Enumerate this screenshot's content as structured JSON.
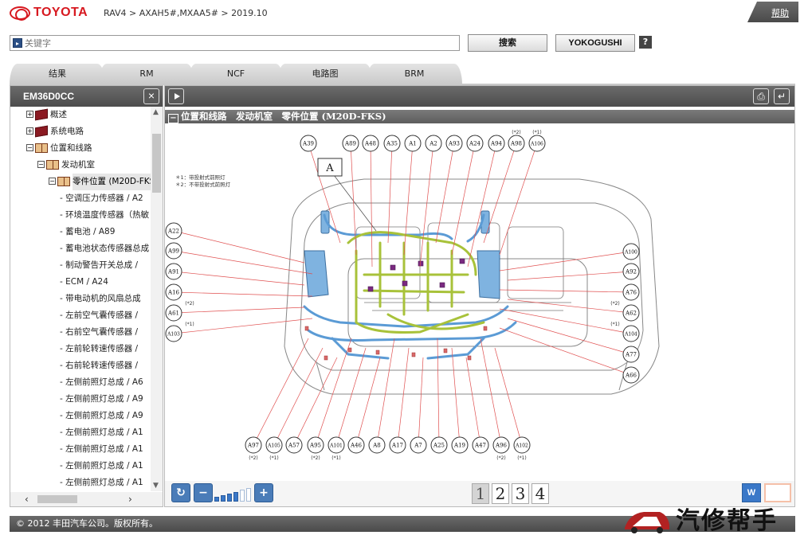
{
  "header": {
    "logo_text": "TOYOTA",
    "breadcrumb": "RAV4 > AXAH5#,MXAA5# > 2019.10",
    "help_label": "帮助"
  },
  "search": {
    "placeholder": "关键字",
    "search_label": "搜索",
    "yoko_label": "YOKOGUSHI",
    "help_icon_label": "?"
  },
  "tabs": [
    "结果",
    "RM",
    "NCF",
    "电路图",
    "BRM"
  ],
  "left_panel": {
    "title": "EM36D0CC",
    "tree": [
      {
        "label": "概述",
        "level": 1,
        "expander": "+",
        "icon": "closed-book-icon"
      },
      {
        "label": "系统电路",
        "level": 1,
        "expander": "+",
        "icon": "closed-book-icon"
      },
      {
        "label": "位置和线路",
        "level": 1,
        "expander": "−",
        "icon": "open-book-icon"
      },
      {
        "label": "发动机室",
        "level": 2,
        "expander": "−",
        "icon": "open-book-icon"
      },
      {
        "label": "零件位置 (M20D-FKS",
        "level": 3,
        "expander": "−",
        "icon": "open-book-icon",
        "selected": true
      },
      {
        "label": "空调压力传感器 / A2",
        "level": 4
      },
      {
        "label": "环境温度传感器（热敏",
        "level": 4
      },
      {
        "label": "蓄电池 / A89",
        "level": 4
      },
      {
        "label": "蓄电池状态传感器总成",
        "level": 4
      },
      {
        "label": "制动警告开关总成 /",
        "level": 4
      },
      {
        "label": "ECM / A24",
        "level": 4
      },
      {
        "label": "带电动机的风扇总成",
        "level": 4
      },
      {
        "label": "左前空气囊传感器 /",
        "level": 4
      },
      {
        "label": "右前空气囊传感器 /",
        "level": 4
      },
      {
        "label": "左前轮转速传感器 /",
        "level": 4
      },
      {
        "label": "右前轮转速传感器 /",
        "level": 4
      },
      {
        "label": "左侧前照灯总成 / A6",
        "level": 4
      },
      {
        "label": "左侧前照灯总成 / A9",
        "level": 4
      },
      {
        "label": "左侧前照灯总成 / A9",
        "level": 4
      },
      {
        "label": "左侧前照灯总成 / A1",
        "level": 4
      },
      {
        "label": "左侧前照灯总成 / A1",
        "level": 4
      },
      {
        "label": "左侧前照灯总成 / A1",
        "level": 4
      },
      {
        "label": "左侧前照灯总成 / A1",
        "level": 4
      }
    ]
  },
  "main": {
    "title_minus": "−",
    "title": "位置和线路　发动机室　零件位置 (M20D-FKS)",
    "legend": [
      "＊1：带投射式前照灯",
      "＊2：不带投射式前照灯"
    ],
    "view_label": "A",
    "top_connectors": [
      {
        "id": "A39",
        "note": ""
      },
      {
        "id": "A89",
        "note": ""
      },
      {
        "id": "A48",
        "note": ""
      },
      {
        "id": "A35",
        "note": ""
      },
      {
        "id": "A1",
        "note": ""
      },
      {
        "id": "A2",
        "note": ""
      },
      {
        "id": "A93",
        "note": ""
      },
      {
        "id": "A24",
        "note": ""
      },
      {
        "id": "A94",
        "note": ""
      },
      {
        "id": "A98",
        "note": "(*2)"
      },
      {
        "id": "A106",
        "note": "(*1)"
      }
    ],
    "left_connectors": [
      {
        "id": "A22",
        "note": ""
      },
      {
        "id": "A99",
        "note": ""
      },
      {
        "id": "A91",
        "note": ""
      },
      {
        "id": "A16",
        "note": ""
      },
      {
        "id": "A61",
        "note": "(*2)"
      },
      {
        "id": "A103",
        "note": "(*1)"
      }
    ],
    "right_connectors": [
      {
        "id": "A100",
        "note": ""
      },
      {
        "id": "A92",
        "note": ""
      },
      {
        "id": "A76",
        "note": ""
      },
      {
        "id": "A62",
        "note": "(*2)"
      },
      {
        "id": "A104",
        "note": "(*1)"
      },
      {
        "id": "A77",
        "note": ""
      },
      {
        "id": "A66",
        "note": ""
      }
    ],
    "bottom_connectors": [
      {
        "id": "A97",
        "note": "(*2)"
      },
      {
        "id": "A105",
        "note": "(*1)"
      },
      {
        "id": "A57",
        "note": ""
      },
      {
        "id": "A95",
        "note": "(*2)"
      },
      {
        "id": "A101",
        "note": "(*1)"
      },
      {
        "id": "A46",
        "note": ""
      },
      {
        "id": "A8",
        "note": ""
      },
      {
        "id": "A17",
        "note": ""
      },
      {
        "id": "A7",
        "note": ""
      },
      {
        "id": "A25",
        "note": ""
      },
      {
        "id": "A19",
        "note": ""
      },
      {
        "id": "A47",
        "note": ""
      },
      {
        "id": "A96",
        "note": "(*2)"
      },
      {
        "id": "A102",
        "note": "(*1)"
      }
    ],
    "pages": [
      "1",
      "2",
      "3",
      "4"
    ],
    "active_page": "1",
    "w_label": "W"
  },
  "footer": {
    "copyright": "© 2012 丰田汽车公司。版权所有。",
    "watermark": "汽修帮手"
  },
  "colors": {
    "toyota_red": "#d71920",
    "header_gray": "#555555",
    "wire_blue": "#5b9bd5",
    "wire_green": "#a8c23a",
    "leader_red": "#e05050",
    "tool_blue": "#3a78c8"
  }
}
